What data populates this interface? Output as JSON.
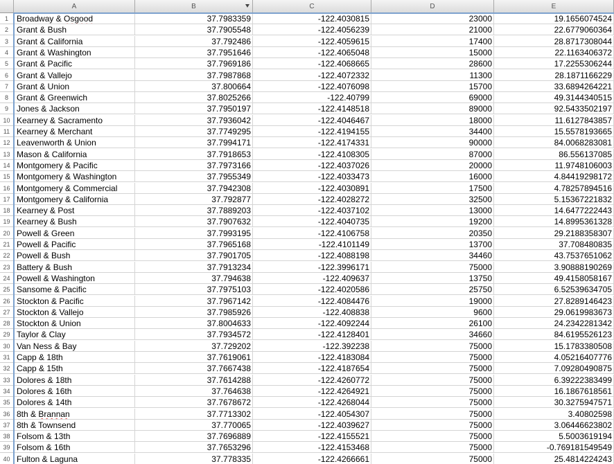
{
  "columns": [
    "A",
    "B",
    "C",
    "D",
    "E"
  ],
  "rows": [
    [
      "Broadway & Osgood",
      "37.7983359",
      "-122.4030815",
      "23000",
      "19.1656074524"
    ],
    [
      "Grant & Bush",
      "37.7905548",
      "-122.4056239",
      "21000",
      "22.6779060364"
    ],
    [
      "Grant & California",
      "37.792486",
      "-122.4059615",
      "17400",
      "28.8717308044"
    ],
    [
      "Grant & Washington",
      "37.7951646",
      "-122.4065048",
      "15000",
      "22.1163406372"
    ],
    [
      "Grant & Pacific",
      "37.7969186",
      "-122.4068665",
      "28600",
      "17.2255306244"
    ],
    [
      "Grant & Vallejo",
      "37.7987868",
      "-122.4072332",
      "11300",
      "28.1871166229"
    ],
    [
      "Grant & Union",
      "37.800664",
      "-122.4076098",
      "15700",
      "33.6894264221"
    ],
    [
      "Grant & Greenwich",
      "37.8025266",
      "-122.40799",
      "69000",
      "49.3144340515"
    ],
    [
      "Jones & Jackson",
      "37.7950197",
      "-122.4148518",
      "89000",
      "92.5433502197"
    ],
    [
      "Kearney & Sacramento",
      "37.7936042",
      "-122.4046467",
      "18000",
      "11.6127843857"
    ],
    [
      "Kearney & Merchant",
      "37.7749295",
      "-122.4194155",
      "34400",
      "15.5578193665"
    ],
    [
      "Leavenworth & Union",
      "37.7994171",
      "-122.4174331",
      "90000",
      "84.0068283081"
    ],
    [
      "Mason & California",
      "37.7918653",
      "-122.4108305",
      "87000",
      "86.556137085"
    ],
    [
      "Montgomery & Pacific",
      "37.7973166",
      "-122.4037026",
      "20000",
      "11.9748106003"
    ],
    [
      "Montgomery & Washington",
      "37.7955349",
      "-122.4033473",
      "16000",
      "4.84419298172"
    ],
    [
      "Montgomery & Commercial",
      "37.7942308",
      "-122.4030891",
      "17500",
      "4.78257894516"
    ],
    [
      "Montgomery & California",
      "37.792877",
      "-122.4028272",
      "32500",
      "5.15367221832"
    ],
    [
      "Kearney & Post",
      "37.7889203",
      "-122.4037102",
      "13000",
      "14.6477222443"
    ],
    [
      "Kearney & Bush",
      "37.7907632",
      "-122.4040735",
      "19200",
      "14.8995361328"
    ],
    [
      "Powell & Green",
      "37.7993195",
      "-122.4106758",
      "20350",
      "29.2188358307"
    ],
    [
      "Powell & Pacific",
      "37.7965168",
      "-122.4101149",
      "13700",
      "37.708480835"
    ],
    [
      "Powell & Bush",
      "37.7901705",
      "-122.4088198",
      "34460",
      "43.7537651062"
    ],
    [
      "Battery & Bush",
      "37.7913234",
      "-122.3996171",
      "75000",
      "3.90888190269"
    ],
    [
      "Powell & Washington",
      "37.794638",
      "-122.409637",
      "13750",
      "49.4158058167"
    ],
    [
      "Sansome & Pacific",
      "37.7975103",
      "-122.4020586",
      "25750",
      "6.52539634705"
    ],
    [
      "Stockton & Pacific",
      "37.7967142",
      "-122.4084476",
      "19000",
      "27.8289146423"
    ],
    [
      "Stockton & Vallejo",
      "37.7985926",
      "-122.408838",
      "9600",
      "29.0619983673"
    ],
    [
      "Stockton & Union",
      "37.8004633",
      "-122.4092244",
      "26100",
      "24.2342281342"
    ],
    [
      "Taylor & Clay",
      "37.7934572",
      "-122.4128401",
      "34660",
      "84.6195526123"
    ],
    [
      "Van Ness & Bay",
      "37.729202",
      "-122.392238",
      "75000",
      "15.1783380508"
    ],
    [
      "Capp & 18th",
      "37.7619061",
      "-122.4183084",
      "75000",
      "4.05216407776"
    ],
    [
      "Capp & 15th",
      "37.7667438",
      "-122.4187654",
      "75000",
      "7.09280490875"
    ],
    [
      "Dolores & 18th",
      "37.7614288",
      "-122.4260772",
      "75000",
      "6.39222383499"
    ],
    [
      "Dolores & 16th",
      "37.764638",
      "-122.4264921",
      "75000",
      "16.1867618561"
    ],
    [
      "Dolores & 14th",
      "37.7678672",
      "-122.4268044",
      "75000",
      "30.3275947571"
    ],
    [
      "8th & Brannan",
      "37.7713302",
      "-122.4054307",
      "75000",
      "3.40802598"
    ],
    [
      "8th & Townsend",
      "37.770065",
      "-122.4039627",
      "75000",
      "3.06446623802"
    ],
    [
      "Folsom & 13th",
      "37.7696889",
      "-122.4155521",
      "75000",
      "5.5003619194"
    ],
    [
      "Folsom & 16th",
      "37.7653296",
      "-122.4153468",
      "75000",
      "-0.769181549549"
    ],
    [
      "Fulton & Laguna",
      "37.778335",
      "-122.4266661",
      "75000",
      "25.4814224243"
    ]
  ],
  "spellcheck_flagged": [
    "Osgood",
    "Sansome",
    "Brannan"
  ],
  "colors": {
    "selection": "#7da2ce",
    "header_bg": "#e6e6e6",
    "gridline": "#d4d4d4"
  }
}
